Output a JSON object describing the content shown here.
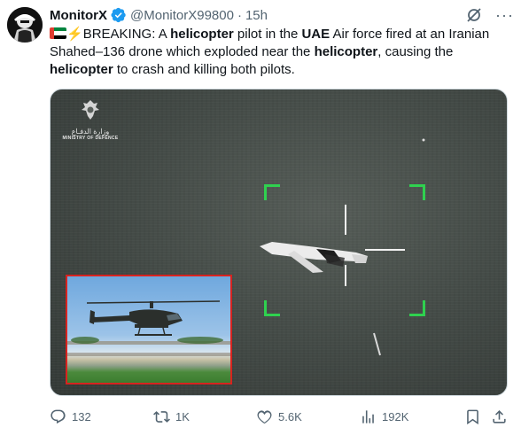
{
  "tweet": {
    "author_name": "MonitorX",
    "handle": "@MonitorX99800",
    "separator": "·",
    "time": "15h",
    "text_segments": [
      {
        "t": "BREAKING: A ",
        "b": false
      },
      {
        "t": "helicopter",
        "b": true
      },
      {
        "t": " pilot in the ",
        "b": false
      },
      {
        "t": "UAE",
        "b": true
      },
      {
        "t": " Air force fired at an Iranian Shahed–136 drone which exploded near the ",
        "b": false
      },
      {
        "t": "helicopter",
        "b": true
      },
      {
        "t": ", causing the ",
        "b": false
      },
      {
        "t": "helicopter",
        "b": true
      },
      {
        "t": " to crash and killing both pilots.",
        "b": false
      }
    ],
    "emoji": {
      "flag": "uae-flag",
      "bolt": "⚡"
    }
  },
  "media": {
    "logo_arabic": "وزارة الدفـاع",
    "logo_english": "MINISTRY OF DEFENCE",
    "overlay_color": "#2fd14f",
    "inset_border_color": "#d8231f"
  },
  "actions": {
    "reply_count": "132",
    "retweet_count": "1K",
    "like_count": "5.6K",
    "views_count": "192K"
  },
  "icons": {
    "verified": "verified-badge-icon",
    "grok": "grok-icon",
    "more": "more-icon",
    "reply": "reply-icon",
    "retweet": "retweet-icon",
    "like": "heart-icon",
    "views": "views-icon",
    "bookmark": "bookmark-icon",
    "share": "share-icon"
  },
  "colors": {
    "verified": "#1d9bf0",
    "muted": "#536471",
    "text": "#0f1419"
  }
}
